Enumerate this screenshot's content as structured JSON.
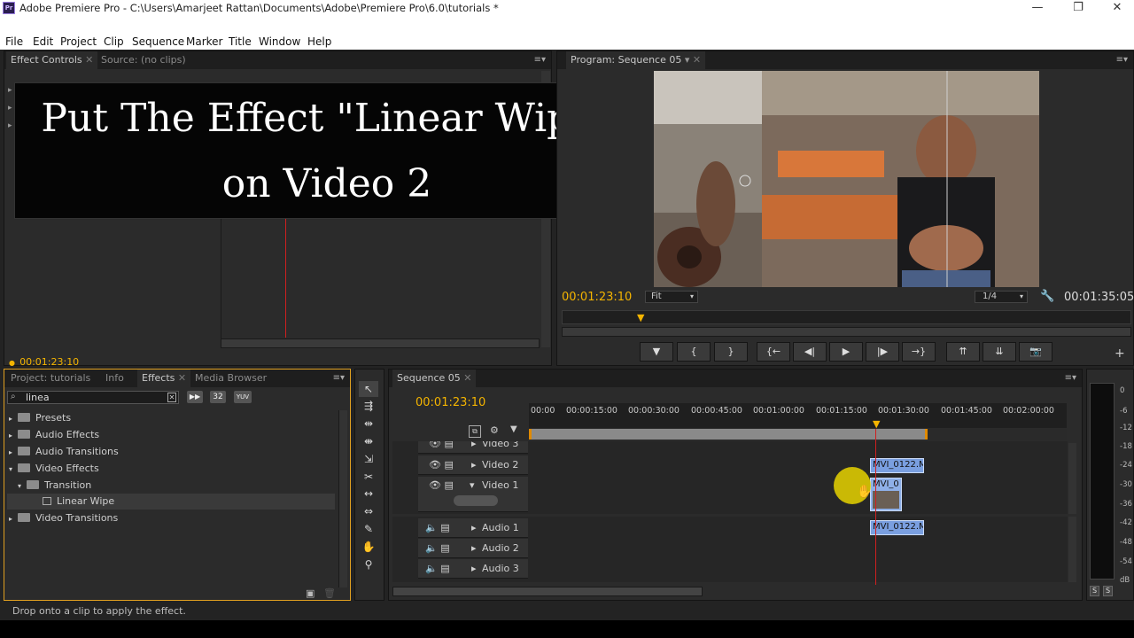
{
  "window": {
    "title": "Adobe Premiere Pro - C:\\Users\\Amarjeet Rattan\\Documents\\Adobe\\Premiere Pro\\6.0\\tutorials *",
    "app_icon": "Pr"
  },
  "menu": [
    "File",
    "Edit",
    "Project",
    "Clip",
    "Sequence",
    "Marker",
    "Title",
    "Window",
    "Help"
  ],
  "source_panel": {
    "tabs": [
      "Effect Controls",
      "Source: (no clips)"
    ],
    "timecode": "00:01:23:10"
  },
  "overlay": {
    "line1": "Put The Effect \"Linear Wipe\"",
    "line2": "on Video 2"
  },
  "program": {
    "tab": "Program: Sequence 05",
    "timecode": "00:01:23:10",
    "fit": "Fit",
    "resolution": "1/4",
    "duration": "00:01:35:05"
  },
  "project_panel": {
    "tabs": [
      "Project: tutorials",
      "Info",
      "Effects",
      "Media Browser"
    ],
    "search_value": "linea",
    "tree": [
      "Presets",
      "Audio Effects",
      "Audio Transitions",
      "Video Effects",
      "Transition",
      "Linear Wipe",
      "Video Transitions"
    ],
    "badges": [
      "32",
      "YUV"
    ]
  },
  "timeline": {
    "tab": "Sequence 05",
    "timecode": "00:01:23:10",
    "ruler": [
      "00:00",
      "00:00:15:00",
      "00:00:30:00",
      "00:00:45:00",
      "00:01:00:00",
      "00:01:15:00",
      "00:01:30:00",
      "00:01:45:00",
      "00:02:00:00"
    ],
    "tracks": [
      "Video 3",
      "Video 2",
      "Video 1",
      "Audio 1",
      "Audio 2",
      "Audio 3"
    ],
    "clips": {
      "v2": "MVI_0122.M",
      "v1": "MVI_0",
      "a1": "MVI_0122.M"
    }
  },
  "meters": {
    "labels": [
      "0",
      "-6",
      "-12",
      "-18",
      "-24",
      "-30",
      "-36",
      "-42",
      "-48",
      "-54",
      "dB"
    ],
    "solo": [
      "S",
      "S"
    ]
  },
  "status": "Drop onto a clip to apply the effect."
}
